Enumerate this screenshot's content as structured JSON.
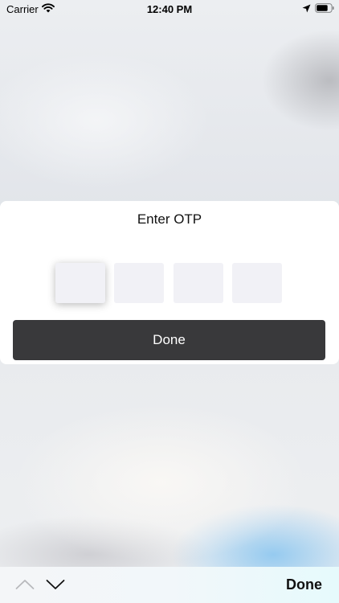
{
  "status_bar": {
    "carrier": "Carrier",
    "time": "12:40 PM",
    "wifi_icon": "wifi-icon",
    "location_icon": "location-arrow-icon",
    "battery_icon": "battery-icon"
  },
  "otp_dialog": {
    "title": "Enter OTP",
    "digits": [
      "",
      "",
      "",
      ""
    ],
    "done_label": "Done",
    "button_color": "#39393b",
    "box_color": "#f1f1f6"
  },
  "keyboard_toolbar": {
    "prev_icon": "chevron-up-icon",
    "next_icon": "chevron-down-icon",
    "done_label": "Done"
  }
}
